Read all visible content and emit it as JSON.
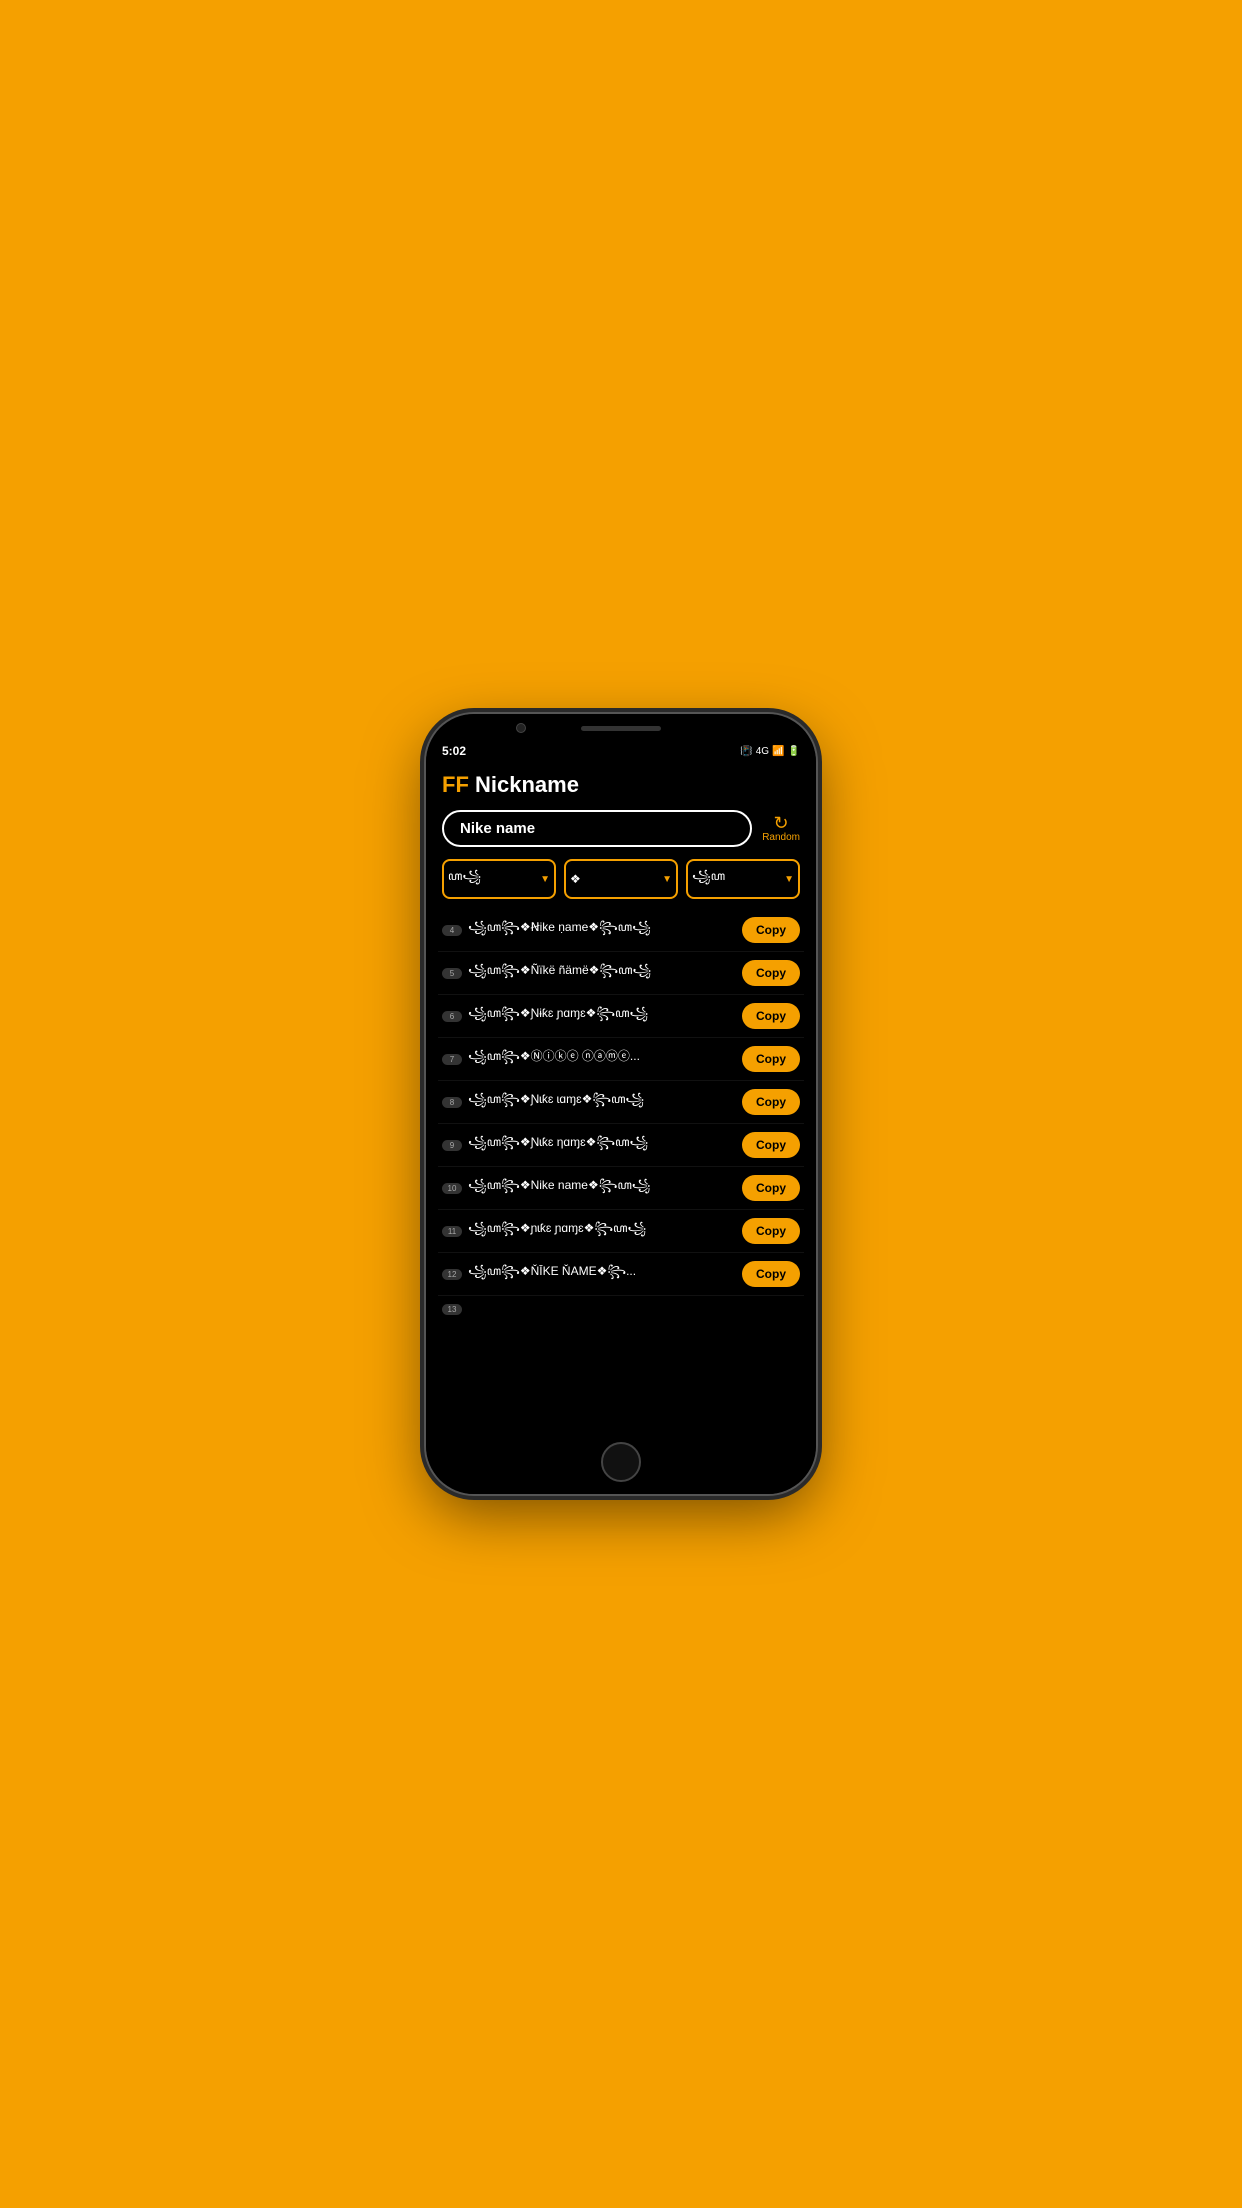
{
  "status": {
    "time": "5:02",
    "icons": "📳 4G 📶 🔋"
  },
  "header": {
    "ff": "FF",
    "title": " Nickname"
  },
  "search": {
    "value": "Nike name",
    "placeholder": "Nike name"
  },
  "random_button": {
    "icon": "↻",
    "label": "Random"
  },
  "filters": [
    {
      "symbol": "ꦲ꧁",
      "has_chevron": true
    },
    {
      "symbol": "❖",
      "has_chevron": true
    },
    {
      "symbol": "꧁ꦲ",
      "has_chevron": true
    }
  ],
  "nicknames": [
    {
      "num": "4",
      "text": "꧁ꦲ꧂❖Ꞥike ṇame❖꧂ꦲ꧁",
      "copy": "Copy"
    },
    {
      "num": "5",
      "text": "꧁ꦲ꧂❖Ñïkë ñämë❖꧂ꦲ꧁",
      "copy": "Copy"
    },
    {
      "num": "6",
      "text": "꧁ꦲ꧂❖Ɲɨƙɛ ɲɑɱɛ❖꧂ꦲ꧁",
      "copy": "Copy"
    },
    {
      "num": "7",
      "text": "꧁ꦲ꧂❖Ⓝⓘⓚⓔ ⓝⓐⓜⓔ...",
      "copy": "Copy"
    },
    {
      "num": "8",
      "text": "꧁ꦲ꧂❖Ɲɩƙɛ ɩɑɱɛ❖꧂ꦲ꧁",
      "copy": "Copy"
    },
    {
      "num": "9",
      "text": "꧁ꦲ꧂❖Ɲɩƙɛ ηɑɱɛ❖꧂ꦲ꧁",
      "copy": "Copy"
    },
    {
      "num": "10",
      "text": "꧁ꦲ꧂❖Nike name❖꧂ꦲ꧁",
      "copy": "Copy"
    },
    {
      "num": "11",
      "text": "꧁ꦲ꧂❖ɲɩƙɛ ɲɑɱɛ❖꧂ꦲ꧁",
      "copy": "Copy"
    },
    {
      "num": "12",
      "text": "꧁ꦲ꧂❖ŇĪKE ŇAME❖꧂...",
      "copy": "Copy"
    }
  ],
  "partial_num": "13"
}
